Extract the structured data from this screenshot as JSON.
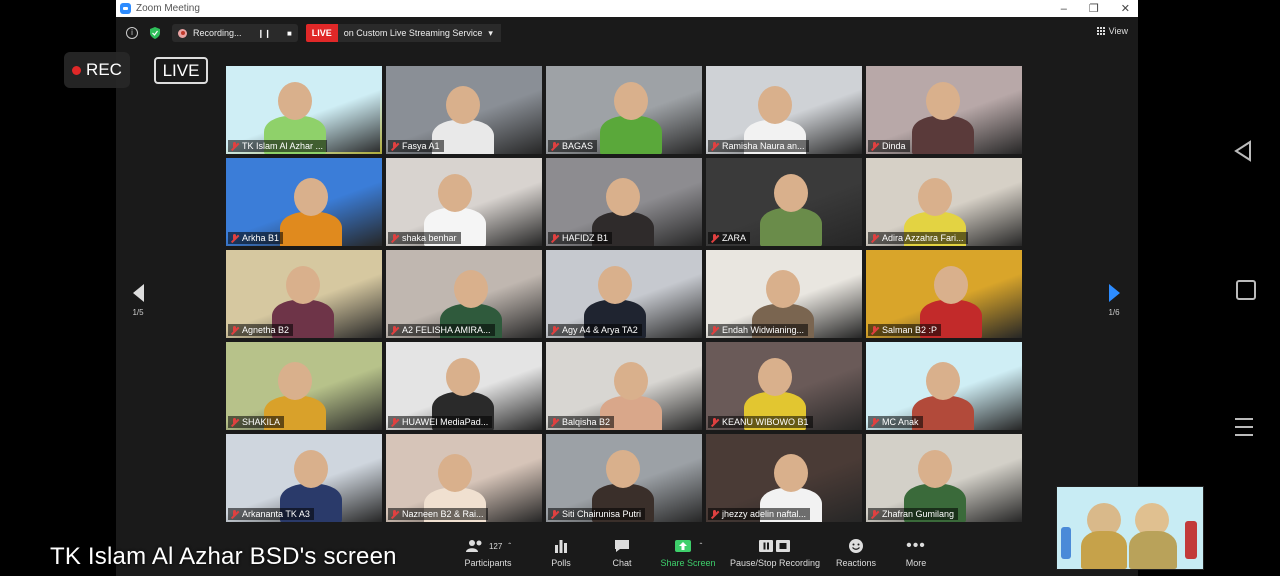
{
  "window": {
    "title": "Zoom Meeting"
  },
  "topbar": {
    "recording_label": "Recording...",
    "live_badge": "LIVE",
    "live_service": "on Custom Live Streaming Service",
    "view_label": "View"
  },
  "overlay": {
    "rec_label": "REC",
    "live_label": "LIVE"
  },
  "pagination": {
    "left": "1/5",
    "right": "1/6"
  },
  "participants": [
    {
      "name": "TK Islam Al Azhar ...",
      "bg": "#cfeef5",
      "accent": "#8fd16a"
    },
    {
      "name": "Fasya A1",
      "bg": "#8a8f96",
      "accent": "#e9e9e9"
    },
    {
      "name": "BAGAS",
      "bg": "#9ea2a6",
      "accent": "#5aa83a"
    },
    {
      "name": "Ramisha Naura an...",
      "bg": "#cfd2d6",
      "accent": "#f2f2f2"
    },
    {
      "name": "Dinda",
      "bg": "#b8a8a8",
      "accent": "#5a3a3a"
    },
    {
      "name": "Arkha B1",
      "bg": "#3b7dd8",
      "accent": "#e08a1e"
    },
    {
      "name": "shaka benhar",
      "bg": "#d8d3cf",
      "accent": "#f5f5f5"
    },
    {
      "name": "HAFIDZ B1",
      "bg": "#8d8c90",
      "accent": "#2f2b2b"
    },
    {
      "name": "ZARA",
      "bg": "#3a3a3a",
      "accent": "#6a8c4a"
    },
    {
      "name": "Adira Azzahra Fari...",
      "bg": "#d6d0c6",
      "accent": "#e3d342"
    },
    {
      "name": "Agnetha B2",
      "bg": "#d6c8a0",
      "accent": "#6e3448"
    },
    {
      "name": "A2 FELISHA AMIRA...",
      "bg": "#c0b7b0",
      "accent": "#2f5a3c"
    },
    {
      "name": "Agy A4 & Arya TA2",
      "bg": "#c6c9cf",
      "accent": "#1f2430"
    },
    {
      "name": "Endah Widwianing...",
      "bg": "#e9e6e0",
      "accent": "#7a6550"
    },
    {
      "name": "Salman B2 :P",
      "bg": "#d9a52a",
      "accent": "#c22a2a"
    },
    {
      "name": "SHAKILA",
      "bg": "#b7c28a",
      "accent": "#d9a12a"
    },
    {
      "name": "HUAWEI MediaPad...",
      "bg": "#e4e4e4",
      "accent": "#2a2a2a"
    },
    {
      "name": "Balqisha B2",
      "bg": "#d8d6d2",
      "accent": "#d9a78a"
    },
    {
      "name": "KEANU WIBOWO B1",
      "bg": "#6a5a58",
      "accent": "#e2c630"
    },
    {
      "name": "MC Anak",
      "bg": "#cfeef5",
      "accent": "#b24a3a"
    },
    {
      "name": "Arkananta TK A3",
      "bg": "#cfd6de",
      "accent": "#2a3a6a"
    },
    {
      "name": "Nazneen B2 & Rai...",
      "bg": "#d6c4b8",
      "accent": "#f0e0d0"
    },
    {
      "name": "Siti Chairunisa Putri",
      "bg": "#9ca1a6",
      "accent": "#3a2f2a"
    },
    {
      "name": "jhezzy adelin naftal...",
      "bg": "#4a3b36",
      "accent": "#f2f2f2"
    },
    {
      "name": "Zhafran Gumilang",
      "bg": "#d3d0c8",
      "accent": "#3a6a3a"
    }
  ],
  "toolbar": {
    "participants_label": "Participants",
    "participants_count": "127",
    "polls_label": "Polls",
    "chat_label": "Chat",
    "share_label": "Share Screen",
    "record_label": "Pause/Stop Recording",
    "reactions_label": "Reactions",
    "more_label": "More"
  },
  "caption": "TK Islam Al Azhar BSD's screen",
  "colors": {
    "accent": "#2d8cff",
    "live": "#e02828",
    "active_speaker": "#e8e34d",
    "share": "#3ecf6b"
  }
}
